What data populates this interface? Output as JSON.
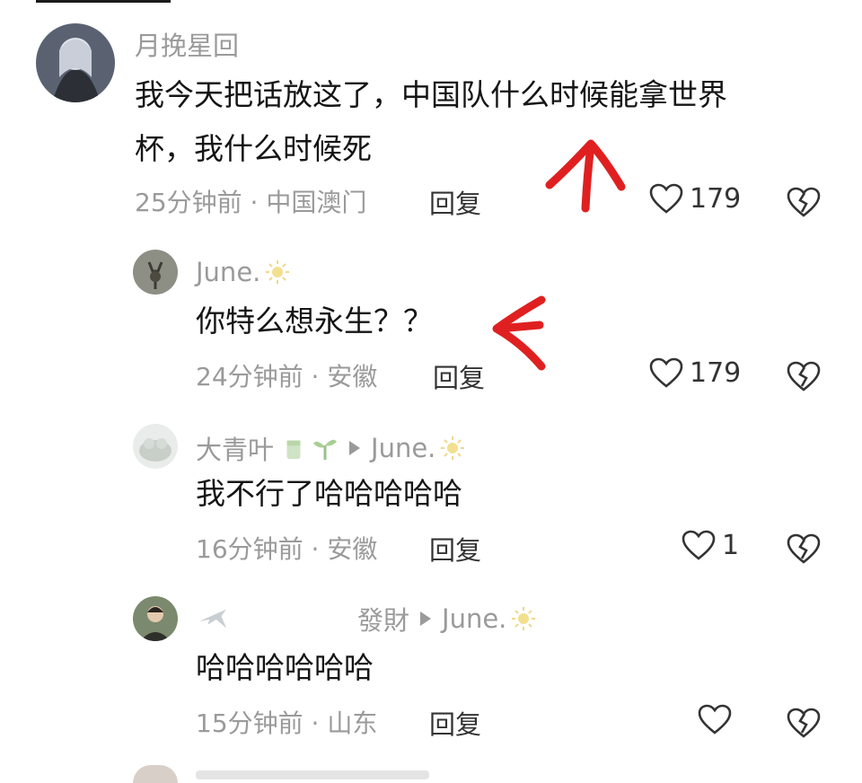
{
  "comments": [
    {
      "username": "月挽星回",
      "text_line1": "我今天把话放这了，中国队什么时候能拿世界",
      "text_line2": "杯，我什么时候死",
      "time": "25分钟前",
      "location": "中国澳门",
      "reply_label": "回复",
      "likes": "179"
    },
    {
      "username": "June.",
      "text": "你特么想永生？？",
      "time": "24分钟前",
      "location": "安徽",
      "reply_label": "回复",
      "likes": "179"
    },
    {
      "username": "大青叶",
      "reply_to": "June.",
      "text": "我不行了哈哈哈哈哈",
      "time": "16分钟前",
      "location": "安徽",
      "reply_label": "回复",
      "likes": "1"
    },
    {
      "username": "發財",
      "reply_to": "June.",
      "text": "哈哈哈哈哈哈",
      "time": "15分钟前",
      "location": "山东",
      "reply_label": "回复",
      "likes": ""
    }
  ],
  "colors": {
    "arrow": "#e02020",
    "muted": "#9a9a9a",
    "text": "#151515"
  }
}
